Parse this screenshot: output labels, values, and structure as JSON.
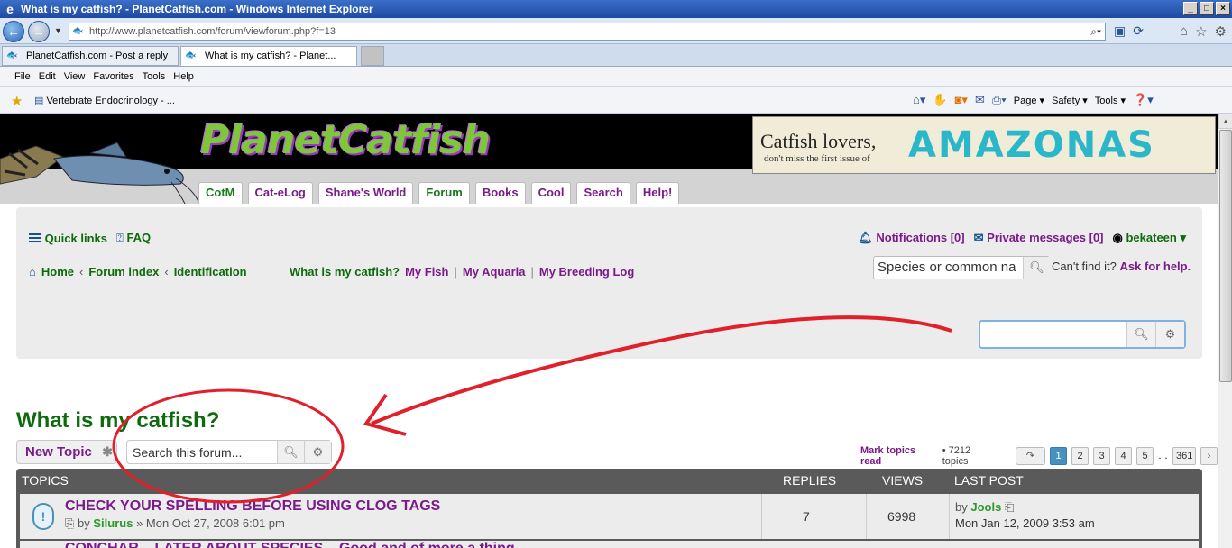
{
  "browser": {
    "title": "What is my catfish? - PlanetCatfish.com - Windows Internet Explorer",
    "url": "http://www.planetcatfish.com/forum/viewforum.php?f=13",
    "tabs": [
      {
        "label": "PlanetCatfish.com - Post a reply"
      },
      {
        "label": "What is my catfish? - Planet..."
      }
    ],
    "menu": [
      "File",
      "Edit",
      "View",
      "Favorites",
      "Tools",
      "Help"
    ],
    "favorite": "Vertebrate Endocrinology - ...",
    "commands": {
      "page": "Page",
      "safety": "Safety",
      "tools": "Tools"
    }
  },
  "site": {
    "logo": "PlanetCatfish",
    "banner": {
      "line1": "Catfish lovers,",
      "line2": "don't miss the first issue of",
      "brand": "AMAZONAS"
    },
    "nav": [
      "CotM",
      "Cat-eLog",
      "Shane's World",
      "Forum",
      "Books",
      "Cool",
      "Search",
      "Help!"
    ]
  },
  "panel": {
    "quick_links": "Quick links",
    "faq": "FAQ",
    "notifications": "Notifications [0]",
    "private_messages": "Private messages [0]",
    "username": "bekateen",
    "breadcrumbs": [
      "Home",
      "Forum index",
      "Identification"
    ],
    "sublinks": [
      "What is my catfish?",
      "My Fish",
      "My Aquaria",
      "My Breeding Log"
    ],
    "species_placeholder": "Species or common na",
    "cant_find": "Can't find it?",
    "ask_help": "Ask for help.",
    "search_value": "-"
  },
  "forum": {
    "title": "What is my catfish?",
    "new_topic": "New Topic",
    "search_placeholder": "Search this forum...",
    "mark_read": "Mark topics read",
    "topic_count": "• 7212 topics",
    "pages": [
      "1",
      "2",
      "3",
      "4",
      "5"
    ],
    "ellipsis": "…",
    "last_page": "361",
    "headers": {
      "topics": "TOPICS",
      "replies": "REPLIES",
      "views": "VIEWS",
      "last_post": "LAST POST"
    },
    "topics": [
      {
        "title": "CHECK YOUR SPELLING BEFORE USING CLOG TAGS",
        "by_prefix": "by",
        "author": "Silurus",
        "date": "» Mon Oct 27, 2008 6:01 pm",
        "replies": "7",
        "views": "6998",
        "last_by": "by",
        "last_author": "Jools",
        "last_date": "Mon Jan 12, 2009 3:53 am"
      },
      {
        "title": "CONCHAR... LATER ABOUT SPECIES... Good and of more a thing"
      }
    ]
  },
  "colors": {
    "accent_purple": "#7a1a8a",
    "accent_green": "#0d6b0d",
    "annotation_red": "#e0202a"
  }
}
